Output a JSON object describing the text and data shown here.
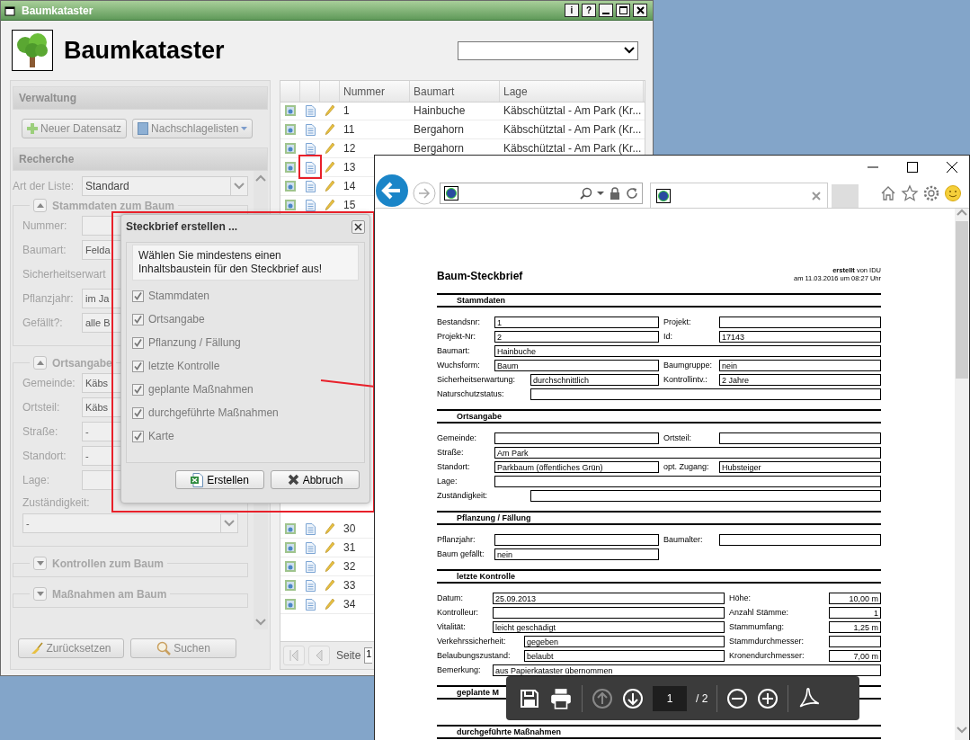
{
  "app": {
    "title": "Baumkataster",
    "title_buttons": [
      "i",
      "?"
    ],
    "heading": "Baumkataster"
  },
  "sidebar": {
    "verwaltung": {
      "title": "Verwaltung",
      "buttons": [
        "Neuer Datensatz",
        "Nachschlagelisten"
      ]
    },
    "recherche": {
      "title": "Recherche",
      "list_type": {
        "label": "Art der Liste:",
        "value": "Standard"
      },
      "fieldsets": [
        {
          "title": "Stammdaten zum Baum",
          "expanded": true,
          "fields": [
            {
              "kind": "input",
              "label": "Nummer:"
            },
            {
              "kind": "input",
              "label": "Baumart:",
              "value": "Felda"
            },
            {
              "kind": "label",
              "label": "Sicherheitserwart"
            },
            {
              "kind": "input",
              "label": "Pflanzjahr:",
              "value": "im Ja"
            },
            {
              "kind": "input",
              "label": "Gefällt?:",
              "value": "alle B"
            }
          ]
        },
        {
          "title": "Ortsangabe",
          "expanded": true,
          "fields": [
            {
              "kind": "input",
              "label": "Gemeinde:",
              "value": "Käbs"
            },
            {
              "kind": "input",
              "label": "Ortsteil:",
              "value": "Käbs"
            },
            {
              "kind": "input",
              "label": "Straße:",
              "value": "-"
            },
            {
              "kind": "input",
              "label": "Standort:",
              "value": "-"
            },
            {
              "kind": "input",
              "label": "Lage:"
            },
            {
              "kind": "select",
              "label": "Zuständigkeit:",
              "value": "-"
            }
          ]
        },
        {
          "title": "Kontrollen zum Baum",
          "expanded": false
        },
        {
          "title": "Maßnahmen am Baum",
          "expanded": false
        }
      ],
      "buttons": [
        "Zurücksetzen",
        "Suchen"
      ]
    }
  },
  "grid": {
    "columns": [
      "Nummer",
      "Baumart",
      "Lage"
    ],
    "row_groups": [
      [
        {
          "nummer": "1",
          "baumart": "Hainbuche",
          "lage": "Käbschütztal - Am Park (Kr..."
        },
        {
          "nummer": "11",
          "baumart": "Bergahorn",
          "lage": "Käbschütztal - Am Park (Kr..."
        },
        {
          "nummer": "12",
          "baumart": "Bergahorn",
          "lage": "Käbschütztal - Am Park (Kr..."
        },
        {
          "nummer": "13"
        },
        {
          "nummer": "14"
        },
        {
          "nummer": "15"
        }
      ],
      [
        {
          "nummer": "30"
        },
        {
          "nummer": "31"
        },
        {
          "nummer": "32"
        },
        {
          "nummer": "33"
        },
        {
          "nummer": "34"
        }
      ]
    ],
    "pager": {
      "label": "Seite",
      "page": "1"
    }
  },
  "dialog": {
    "title": "Steckbrief erstellen ...",
    "message": "Wählen Sie mindestens einen Inhaltsbaustein für den Steckbrief aus!",
    "options": [
      {
        "label": "Stammdaten",
        "checked": true
      },
      {
        "label": "Ortsangabe",
        "checked": true
      },
      {
        "label": "Pflanzung / Fällung",
        "checked": true
      },
      {
        "label": "letzte Kontrolle",
        "checked": true
      },
      {
        "label": "geplante Maßnahmen",
        "checked": true
      },
      {
        "label": "durchgeführte Maßnahmen",
        "checked": true
      },
      {
        "label": "Karte",
        "checked": true
      }
    ],
    "buttons": [
      "Erstellen",
      "Abbruch"
    ]
  },
  "browser": {
    "pdf": {
      "title": "Baum-Steckbrief",
      "meta": [
        "**erstellt** von IDU",
        "am 11.03.2016 um 08:27 Uhr"
      ],
      "sections": [
        {
          "title": "Stammdaten",
          "rows": [
            {
              "kind": "std",
              "fields": [
                {
                  "label": "Bestandsnr:",
                  "value": "1"
                },
                {
                  "label": "Projekt:"
                }
              ]
            },
            {
              "kind": "std",
              "fields": [
                {
                  "label": "Projekt-Nr:",
                  "value": "2"
                },
                {
                  "label": "Id:",
                  "value": "17143"
                }
              ]
            },
            {
              "kind": "std",
              "fields": [
                {
                  "label": "Baumart:",
                  "value": "Hainbuche"
                }
              ]
            },
            {
              "kind": "std",
              "fields": [
                {
                  "label": "Wuchsform:",
                  "value": "Baum"
                },
                {
                  "label": "Baumgruppe:",
                  "value": "nein"
                }
              ]
            },
            {
              "kind": "long",
              "fields": [
                {
                  "label": "Sicherheitserwartung:",
                  "value": "durchschnittlich"
                },
                {
                  "label": "Kontrollintv.:",
                  "value": "2 Jahre"
                }
              ]
            },
            {
              "kind": "long",
              "fields": [
                {
                  "label": "Naturschutzstatus:"
                }
              ]
            }
          ]
        },
        {
          "title": "Ortsangabe",
          "rows": [
            {
              "kind": "std",
              "fields": [
                {
                  "label": "Gemeinde:"
                },
                {
                  "label": "Ortsteil:"
                }
              ]
            },
            {
              "kind": "std",
              "fields": [
                {
                  "label": "Straße:",
                  "value": "Am Park"
                }
              ]
            },
            {
              "kind": "std",
              "fields": [
                {
                  "label": "Standort:",
                  "value": "Parkbaum (öffentliches Grün)"
                },
                {
                  "label": "opt. Zugang:",
                  "value": "Hubsteiger"
                }
              ]
            },
            {
              "kind": "std",
              "fields": [
                {
                  "label": "Lage:"
                }
              ]
            },
            {
              "kind": "long",
              "fields": [
                {
                  "label": "Zuständigkeit:"
                }
              ]
            }
          ]
        },
        {
          "title": "Pflanzung / Fällung",
          "rows": [
            {
              "kind": "std",
              "fields": [
                {
                  "label": "Pflanzjahr:"
                },
                {
                  "label": "Baumalter:"
                }
              ]
            },
            {
              "kind": "std-half",
              "fields": [
                {
                  "label": "Baum gefällt:",
                  "value": "nein"
                }
              ]
            }
          ]
        },
        {
          "title": "letzte Kontrolle",
          "rows": [
            {
              "kind": "kontrolle",
              "fields": [
                {
                  "label": "Datum:",
                  "value": "25.09.2013"
                },
                {
                  "label": "Höhe:",
                  "value": "10,00 m"
                }
              ]
            },
            {
              "kind": "kontrolle",
              "fields": [
                {
                  "label": "Kontrolleur:"
                },
                {
                  "label": "Anzahl Stämme:",
                  "value": "1"
                }
              ]
            },
            {
              "kind": "kontrolle",
              "fields": [
                {
                  "label": "Vitalität:",
                  "value": "leicht geschädigt"
                },
                {
                  "label": "Stammumfang:",
                  "value": "1,25 m"
                }
              ]
            },
            {
              "kind": "kontrolle-long",
              "fields": [
                {
                  "label": "Verkehrssicherheit:",
                  "value": "gegeben"
                },
                {
                  "label": "Stammdurchmesser:"
                }
              ]
            },
            {
              "kind": "kontrolle-long",
              "fields": [
                {
                  "label": "Belaubungszustand:",
                  "value": "belaubt"
                },
                {
                  "label": "Kronendurchmesser:",
                  "value": "7,00 m"
                }
              ]
            },
            {
              "kind": "kontrolle",
              "fields": [
                {
                  "label": "Bemerkung:",
                  "value": "aus Papierkataster übernommen"
                }
              ]
            }
          ]
        },
        {
          "title": "geplante M"
        },
        {
          "title": "durchgeführte Maßnahmen"
        }
      ]
    },
    "toolbar": {
      "page": "1",
      "total": "/ 2"
    }
  }
}
